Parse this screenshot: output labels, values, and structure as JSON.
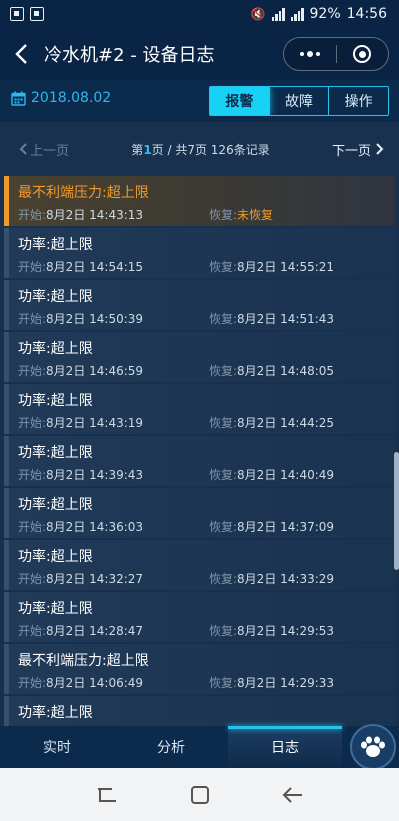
{
  "status_bar": {
    "battery": "92%",
    "time": "14:56"
  },
  "header": {
    "title": "冷水机#2 - 设备日志"
  },
  "toolbar": {
    "date": "2018.08.02",
    "tabs": [
      {
        "label": "报警",
        "active": true
      },
      {
        "label": "故障",
        "active": false
      },
      {
        "label": "操作",
        "active": false
      }
    ]
  },
  "pager": {
    "prev": "上一页",
    "next": "下一页",
    "info_prefix": "第",
    "current": "1",
    "info_suffix": "页 / 共7页 126条记录"
  },
  "records": [
    {
      "name": "最不利端压力:超上限",
      "start_label": "开始:",
      "start": "8月2日 14:43:13",
      "end_label": "恢复:",
      "end": "未恢复",
      "alert": true
    },
    {
      "name": "功率:超上限",
      "start_label": "开始:",
      "start": "8月2日 14:54:15",
      "end_label": "恢复:",
      "end": "8月2日 14:55:21",
      "alert": false
    },
    {
      "name": "功率:超上限",
      "start_label": "开始:",
      "start": "8月2日 14:50:39",
      "end_label": "恢复:",
      "end": "8月2日 14:51:43",
      "alert": false
    },
    {
      "name": "功率:超上限",
      "start_label": "开始:",
      "start": "8月2日 14:46:59",
      "end_label": "恢复:",
      "end": "8月2日 14:48:05",
      "alert": false
    },
    {
      "name": "功率:超上限",
      "start_label": "开始:",
      "start": "8月2日 14:43:19",
      "end_label": "恢复:",
      "end": "8月2日 14:44:25",
      "alert": false
    },
    {
      "name": "功率:超上限",
      "start_label": "开始:",
      "start": "8月2日 14:39:43",
      "end_label": "恢复:",
      "end": "8月2日 14:40:49",
      "alert": false
    },
    {
      "name": "功率:超上限",
      "start_label": "开始:",
      "start": "8月2日 14:36:03",
      "end_label": "恢复:",
      "end": "8月2日 14:37:09",
      "alert": false
    },
    {
      "name": "功率:超上限",
      "start_label": "开始:",
      "start": "8月2日 14:32:27",
      "end_label": "恢复:",
      "end": "8月2日 14:33:29",
      "alert": false
    },
    {
      "name": "功率:超上限",
      "start_label": "开始:",
      "start": "8月2日 14:28:47",
      "end_label": "恢复:",
      "end": "8月2日 14:29:53",
      "alert": false
    },
    {
      "name": "最不利端压力:超上限",
      "start_label": "开始:",
      "start": "8月2日 14:06:49",
      "end_label": "恢复:",
      "end": "8月2日 14:29:33",
      "alert": false
    },
    {
      "name": "功率:超上限",
      "start_label": "",
      "start": "",
      "end_label": "",
      "end": "",
      "alert": false
    }
  ],
  "bottom_nav": {
    "tabs": [
      {
        "label": "实时",
        "active": false
      },
      {
        "label": "分析",
        "active": false
      },
      {
        "label": "日志",
        "active": true
      }
    ]
  },
  "colors": {
    "accent": "#27c3ee",
    "alert": "#f19a2c",
    "background": "#0b2a4c"
  }
}
